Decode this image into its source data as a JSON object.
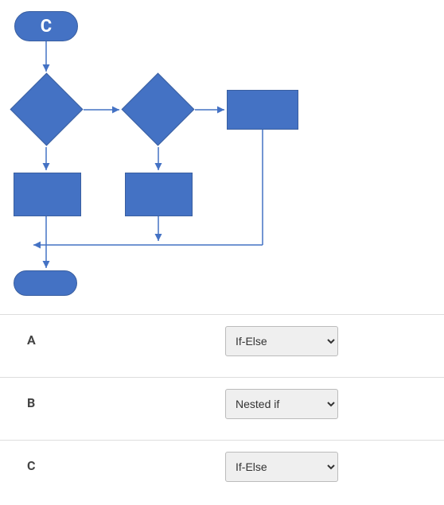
{
  "diagram": {
    "start_label": "C",
    "nodes": {
      "start": {
        "type": "terminator",
        "label": "C"
      },
      "d1": {
        "type": "decision"
      },
      "d2": {
        "type": "decision"
      },
      "r_right": {
        "type": "process"
      },
      "r_left": {
        "type": "process"
      },
      "r_mid": {
        "type": "process"
      },
      "end": {
        "type": "terminator"
      }
    }
  },
  "answers": {
    "rows": [
      {
        "label": "A",
        "selected": "If-Else"
      },
      {
        "label": "B",
        "selected": "Nested if"
      },
      {
        "label": "C",
        "selected": "If-Else"
      }
    ],
    "options": [
      "If-Else",
      "Nested if"
    ]
  }
}
